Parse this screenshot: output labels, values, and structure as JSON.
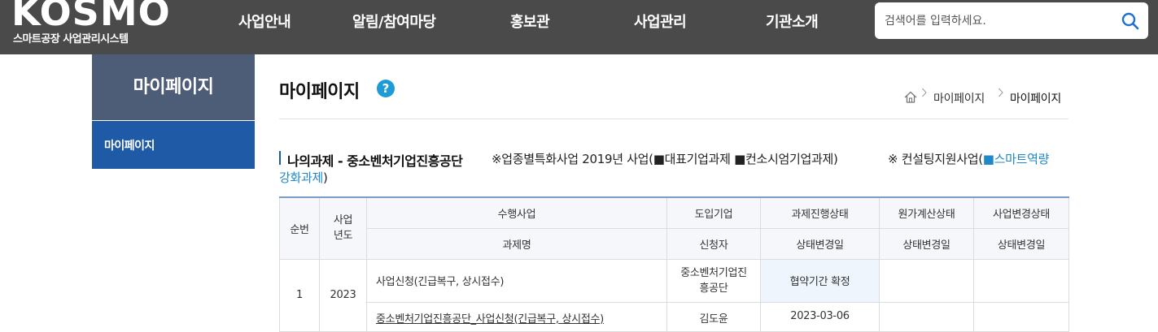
{
  "header": {
    "logo_word": "KOSMO",
    "logo_sub": "스마트공장 사업관리시스템",
    "nav": [
      "사업안내",
      "알림/참여마당",
      "홍보관",
      "사업관리",
      "기관소개"
    ],
    "search_placeholder": "검색어를 입력하세요."
  },
  "sidebar": {
    "title": "마이페이지",
    "items": [
      {
        "label": "마이페이지"
      }
    ]
  },
  "page": {
    "title": "마이페이지",
    "help_icon": "?",
    "breadcrumb": [
      "마이페이지",
      "마이페이지"
    ]
  },
  "section": {
    "title": "나의과제 - 중소벤처기업진흥공단",
    "note1": "※업종별특화사업 2019년 사업(■대표기업과제  ■컨소시엄기업과제)",
    "note2_prefix": "※ 컨설팅지원사업(",
    "note2_link_a": "■스마트역량",
    "note2_link_b": "강화과제",
    "note2_suffix": ")"
  },
  "table": {
    "headers": {
      "no": "순번",
      "year": "사업\n년도",
      "business": "수행사업",
      "company": "도입기업",
      "status": "과제진행상태",
      "cost_status": "원가계산상태",
      "change_status": "사업변경상태",
      "project_name": "과제명",
      "applicant": "신청자",
      "status_date": "상태변경일",
      "cost_date": "상태변경일",
      "change_date": "상태변경일"
    },
    "rows": [
      {
        "no": "1",
        "year": "2023",
        "business": "사업신청(긴급복구, 상시접수)",
        "company": "중소벤처기업진\n흥공단",
        "status": "협약기간 확정",
        "cost_status": "",
        "change_status": "",
        "project_name": "중소벤처기업진흥공단_사업신청(긴급복구, 상시접수)",
        "applicant": "김도윤",
        "status_date": "2023-03-06",
        "cost_date": "",
        "change_date": ""
      }
    ]
  },
  "colors": {
    "header_bg": "#4a4a4a",
    "sidebar_head": "#4e5d77",
    "sidebar_active": "#1f5aa6",
    "accent": "#1e9ad6",
    "link": "#1e88c8"
  }
}
